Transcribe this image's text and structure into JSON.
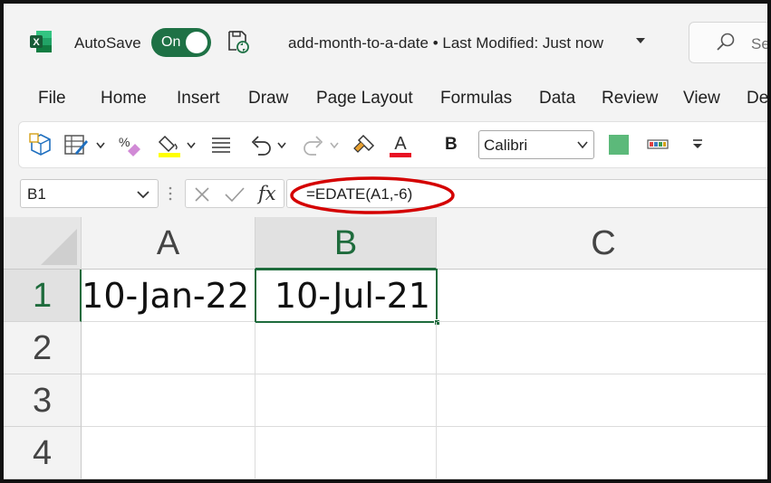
{
  "app": {
    "autosave_label": "AutoSave",
    "autosave_state": "On",
    "document_title": "add-month-to-a-date • Last Modified: Just now",
    "search_placeholder": "Se"
  },
  "menu": [
    "File",
    "Home",
    "Insert",
    "Draw",
    "Page Layout",
    "Formulas",
    "Data",
    "Review",
    "View",
    "De"
  ],
  "toolbar": {
    "font_name": "Calibri",
    "bold_label": "B",
    "font_color_label": "A",
    "highlight_color": "#ffff00",
    "font_color": "#e81123",
    "fill_swatch_color": "#5cb97a"
  },
  "formula_bar": {
    "name_box": "B1",
    "fx_label": "fx",
    "formula": "=EDATE(A1,-6)"
  },
  "grid": {
    "columns": [
      "A",
      "B",
      "C"
    ],
    "rows": [
      "1",
      "2",
      "3",
      "4"
    ],
    "active_column": "B",
    "active_row": "1",
    "cells": {
      "A1": "10-Jan-22",
      "B1": "10-Jul-21"
    }
  },
  "colors": {
    "excel_green": "#1e7145",
    "selection_green": "#1e6b3c",
    "annotation_red": "#d40000"
  }
}
